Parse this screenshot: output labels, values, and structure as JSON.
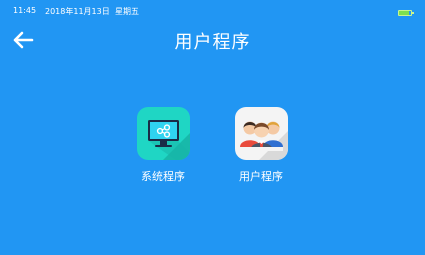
{
  "status_bar": {
    "time": "11:45",
    "date": "2018年11月13日",
    "weekday": "星期五",
    "battery_level": 0.8,
    "battery_color": "#7ee04e"
  },
  "header": {
    "title": "用户程序",
    "back_icon": "arrow-left-icon"
  },
  "apps": [
    {
      "label": "系统程序",
      "icon": "monitor-share-icon",
      "color": "#1fd6c4"
    },
    {
      "label": "用户程序",
      "icon": "users-group-icon",
      "color": "#f4f4f4"
    }
  ],
  "theme": {
    "background": "#2196F3",
    "text": "#ffffff"
  }
}
